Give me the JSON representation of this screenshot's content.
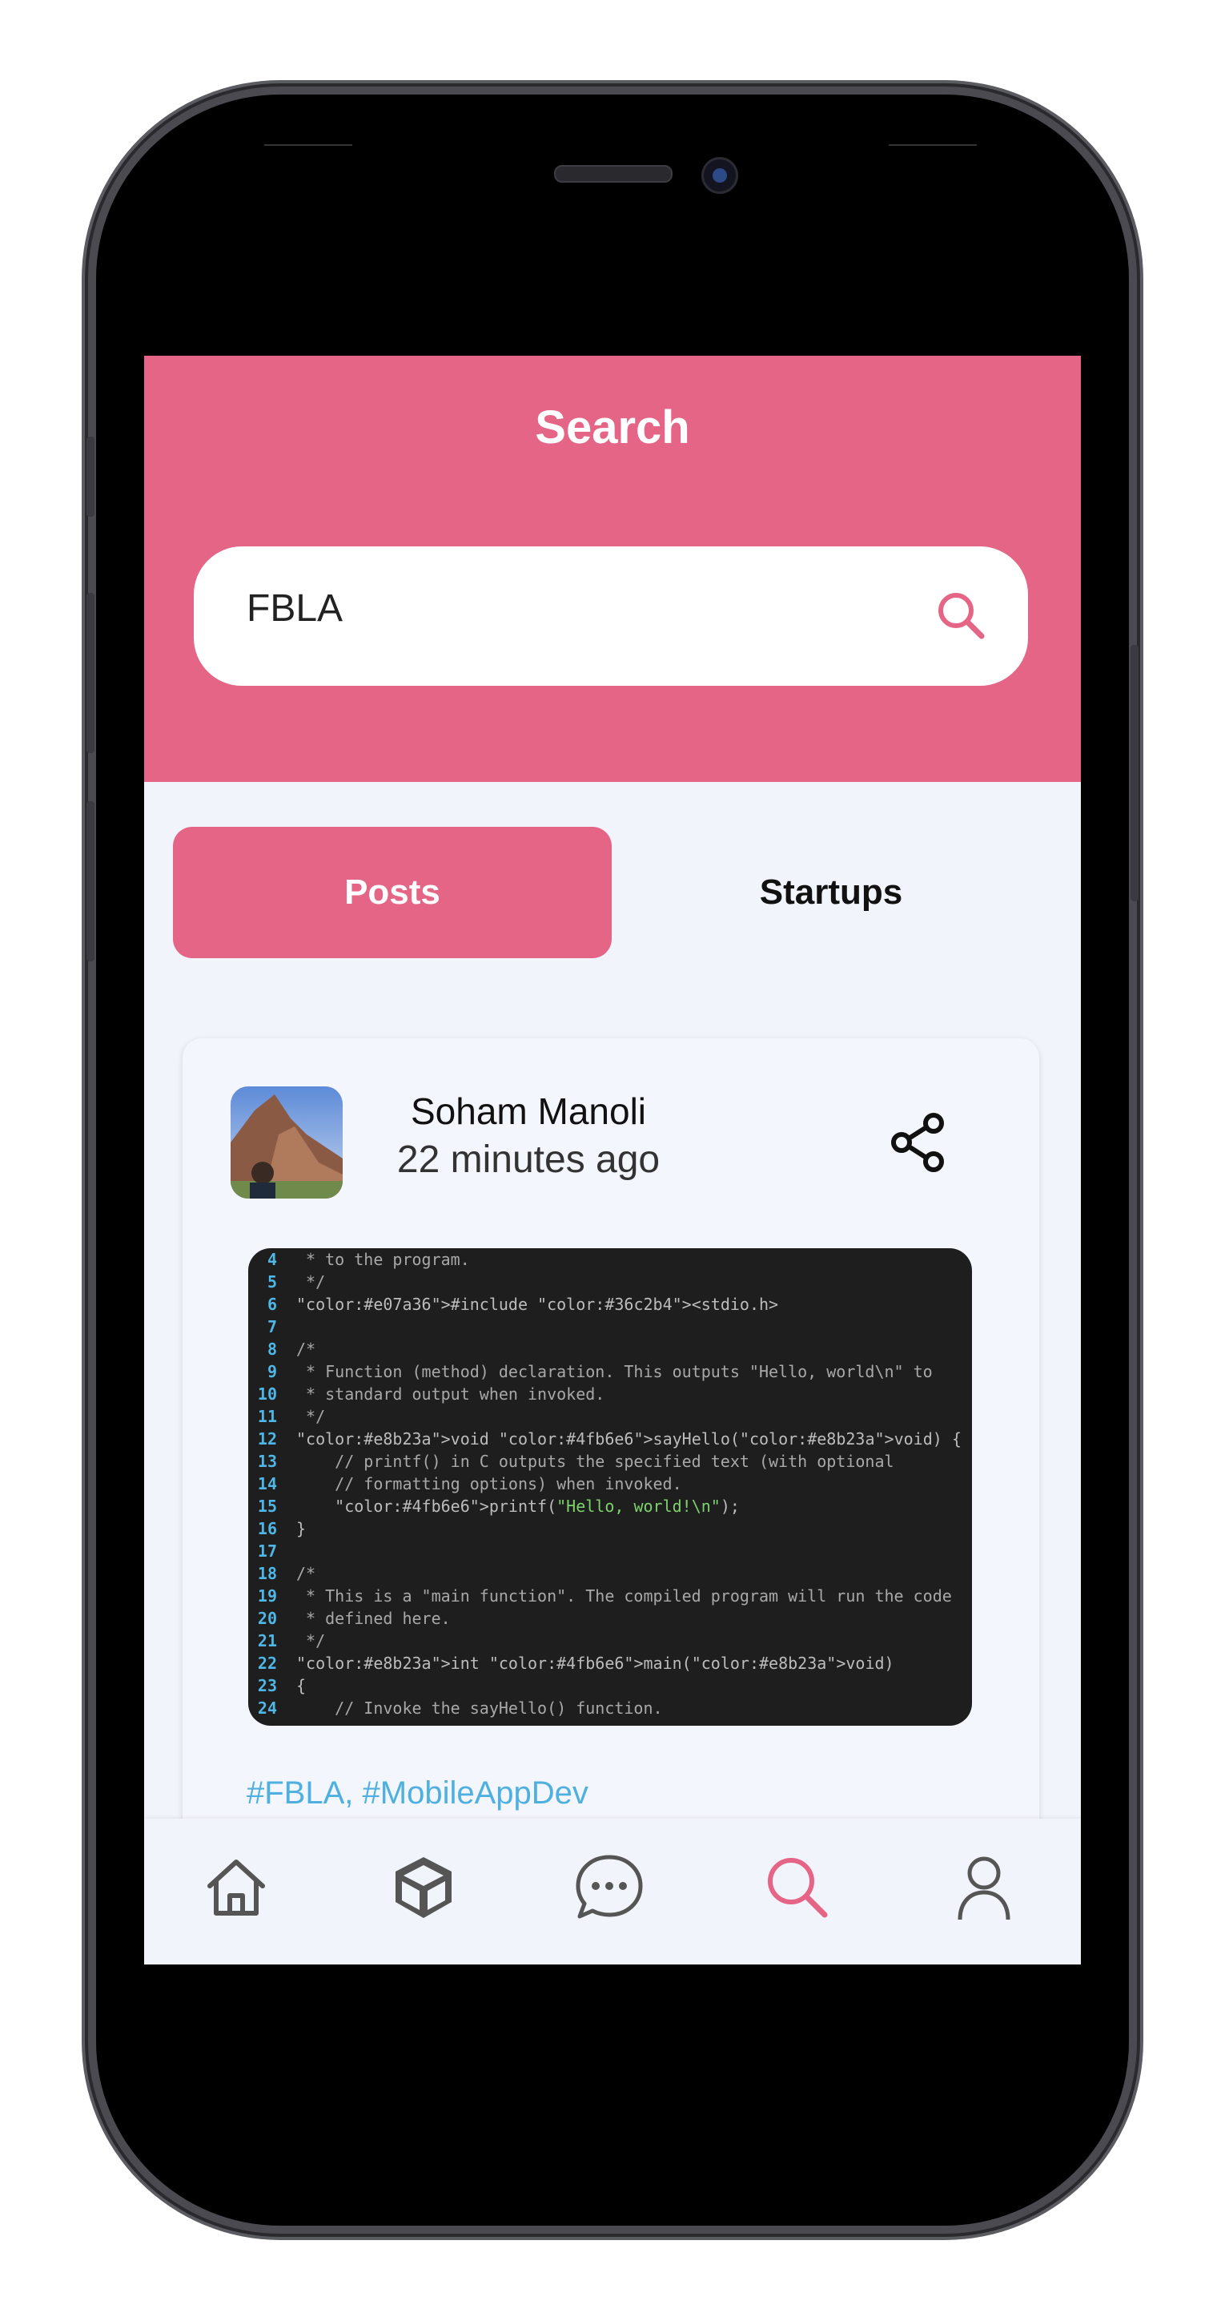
{
  "header": {
    "title": "Search"
  },
  "search": {
    "value": "FBLA",
    "icon": "search-icon",
    "accent": "#e56586"
  },
  "tabs": [
    {
      "label": "Posts",
      "active": true
    },
    {
      "label": "Startups",
      "active": false
    }
  ],
  "post": {
    "author": "Soham Manoli",
    "time": "22 minutes ago",
    "hashtags": "#FBLA, #MobileAppDev",
    "code_lines": [
      {
        "n": "4",
        "text": " * to the program."
      },
      {
        "n": "5",
        "text": " */"
      },
      {
        "n": "6",
        "text": "#include <stdio.h>"
      },
      {
        "n": "7",
        "text": ""
      },
      {
        "n": "8",
        "text": "/*"
      },
      {
        "n": "9",
        "text": " * Function (method) declaration. This outputs \"Hello, world\\n\" to"
      },
      {
        "n": "10",
        "text": " * standard output when invoked."
      },
      {
        "n": "11",
        "text": " */"
      },
      {
        "n": "12",
        "text": "void sayHello(void) {"
      },
      {
        "n": "13",
        "text": "    // printf() in C outputs the specified text (with optional"
      },
      {
        "n": "14",
        "text": "    // formatting options) when invoked."
      },
      {
        "n": "15",
        "text": "    printf(\"Hello, world!\\n\");"
      },
      {
        "n": "16",
        "text": "}"
      },
      {
        "n": "17",
        "text": ""
      },
      {
        "n": "18",
        "text": "/*"
      },
      {
        "n": "19",
        "text": " * This is a \"main function\". The compiled program will run the code"
      },
      {
        "n": "20",
        "text": " * defined here."
      },
      {
        "n": "21",
        "text": " */"
      },
      {
        "n": "22",
        "text": "int main(void)"
      },
      {
        "n": "23",
        "text": "{"
      },
      {
        "n": "24",
        "text": "    // Invoke the sayHello() function."
      }
    ]
  },
  "bottom_nav": [
    {
      "icon": "home-icon",
      "active": false
    },
    {
      "icon": "cube-icon",
      "active": false
    },
    {
      "icon": "chat-icon",
      "active": false
    },
    {
      "icon": "search-icon",
      "active": true
    },
    {
      "icon": "profile-icon",
      "active": false
    }
  ]
}
